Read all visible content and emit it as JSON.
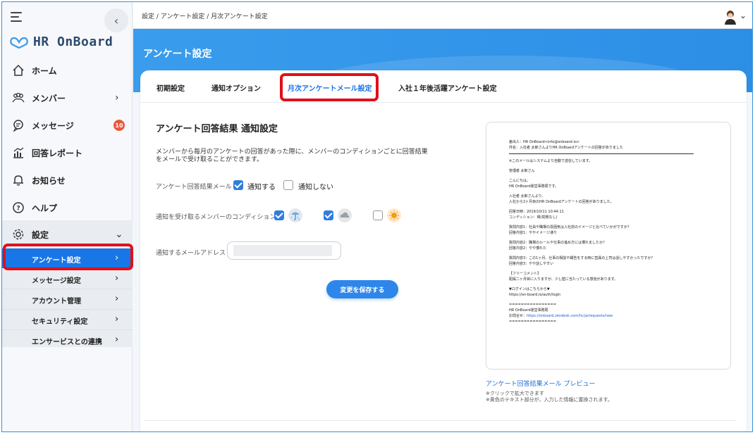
{
  "sidebar": {
    "logo_text": "HR OnBoard",
    "items": [
      {
        "label": "ホーム"
      },
      {
        "label": "メンバー"
      },
      {
        "label": "メッセージ",
        "badge": "10"
      },
      {
        "label": "回答レポート"
      },
      {
        "label": "お知らせ"
      },
      {
        "label": "ヘルプ"
      },
      {
        "label": "設定"
      }
    ],
    "sub_items": [
      {
        "label": "アンケート設定"
      },
      {
        "label": "メッセージ設定"
      },
      {
        "label": "アカウント管理"
      },
      {
        "label": "セキュリティ設定"
      },
      {
        "label": "エンサービスとの連携"
      }
    ]
  },
  "topbar": {
    "breadcrumb": "設定 / アンケート設定 / 月次アンケート設定"
  },
  "header": {
    "title": "アンケート設定"
  },
  "tabs": [
    {
      "label": "初期設定"
    },
    {
      "label": "通知オプション"
    },
    {
      "label": "月次アンケートメール設定"
    },
    {
      "label": "入社１年後活躍アンケート設定"
    }
  ],
  "form": {
    "section_title": "アンケート回答結果 通知設定",
    "description": "メンバーから毎月のアンケートの回答があった際に、メンバーのコンディションごとに回答結果をメールで受け取ることができます。",
    "result_mail_label": "アンケート回答結果メール",
    "notify_option": "通知する",
    "no_notify_option": "通知しない",
    "condition_label": "通知を受け取るメンバーのコンディション",
    "email_label": "通知するメールアドレス",
    "save_button": "変更を保存する"
  },
  "preview": {
    "lines": [
      "差出人：HR OnBoard<info@onboard.io>",
      "件名：入社者 太郎さんよりHR OnBoardアンケートの回答がありました",
      "--hr--",
      "※このメールはシステムより自動で送信しています。",
      "",
      "管理者 太郎さん",
      "",
      "こんにちは。",
      "HR OnBoard運営事務局です。",
      "",
      "入社者 太郎さんより、",
      "入社から2ヶ月目のHR OnBoardアンケートの回答がありました。",
      "",
      "回答日時：2019/10/11 10:44:11",
      "コンディション：晴(問題なし)",
      "",
      "質問内容1：社員や職場の雰囲気は入社前のイメージと比べていかがですか？",
      "回答内容1：ややイメージ通り",
      "",
      "質問内容2：職場のルールや仕事の進め方には慣れましたか？",
      "回答内容2：やや慣れた",
      "",
      "質問内容3：この1ヶ月、仕事の相談や報告をする時に直属の上司は話しやすかったですか？",
      "回答内容3：やや話しやすい",
      "",
      "【フリーコメント】",
      "配属二ヶ月目に入りますが、少し壁に当たっている感覚があります。",
      "",
      "▼ログインはこちらから▼",
      "https://on-board.io/auth/login",
      "",
      "================",
      "HR OnBoard運営事務局",
      "お問合せ：https://onboard.zendesk.com/hc/ja/requests/new",
      "================"
    ],
    "link_text": "アンケート回答結果メール プレビュー",
    "note1": "※クリックで拡大できます",
    "note2": "※黄色のテキスト部分が、入力した情報に置換されます。"
  },
  "colors": {
    "accent": "#1a73e8",
    "highlight": "#e0101a",
    "badge": "#e8593c"
  }
}
